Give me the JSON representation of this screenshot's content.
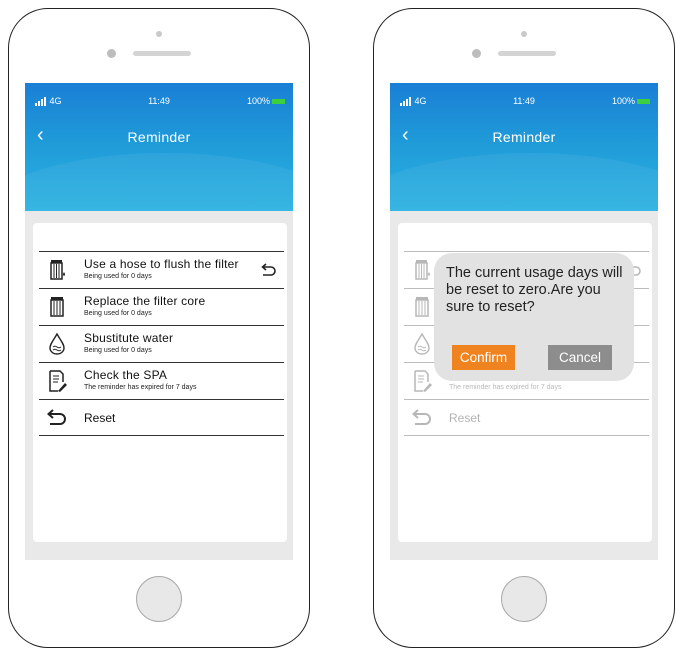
{
  "status_bar": {
    "network": "4G",
    "time": "11:49",
    "battery": "100%"
  },
  "header": {
    "title": "Reminder"
  },
  "items": [
    {
      "title": "Use a hose to flush the filter",
      "subtitle": "Being used for 0 days",
      "icon": "filter-droplet-icon",
      "action_icon": "undo-icon"
    },
    {
      "title": "Replace the filter core",
      "subtitle": "Being used for 0 days",
      "icon": "filter-cartridge-icon"
    },
    {
      "title": "Sbustitute water",
      "subtitle": "Being used for 0 days",
      "icon": "water-drop-icon"
    },
    {
      "title": "Check the SPA",
      "subtitle": "The reminder has expired for 7 days",
      "icon": "checklist-pen-icon"
    },
    {
      "title": "Reset",
      "icon": "reset-arrow-icon"
    }
  ],
  "dialog": {
    "message": "The current usage days will be reset to zero.Are you sure to reset?",
    "confirm_label": "Confirm",
    "cancel_label": "Cancel"
  },
  "colors": {
    "header_gradient_top": "#1a7fd6",
    "header_gradient_bottom": "#2bb2e1",
    "confirm": "#ef8320",
    "cancel": "#8d8d8d",
    "battery": "#3ecf3e"
  }
}
